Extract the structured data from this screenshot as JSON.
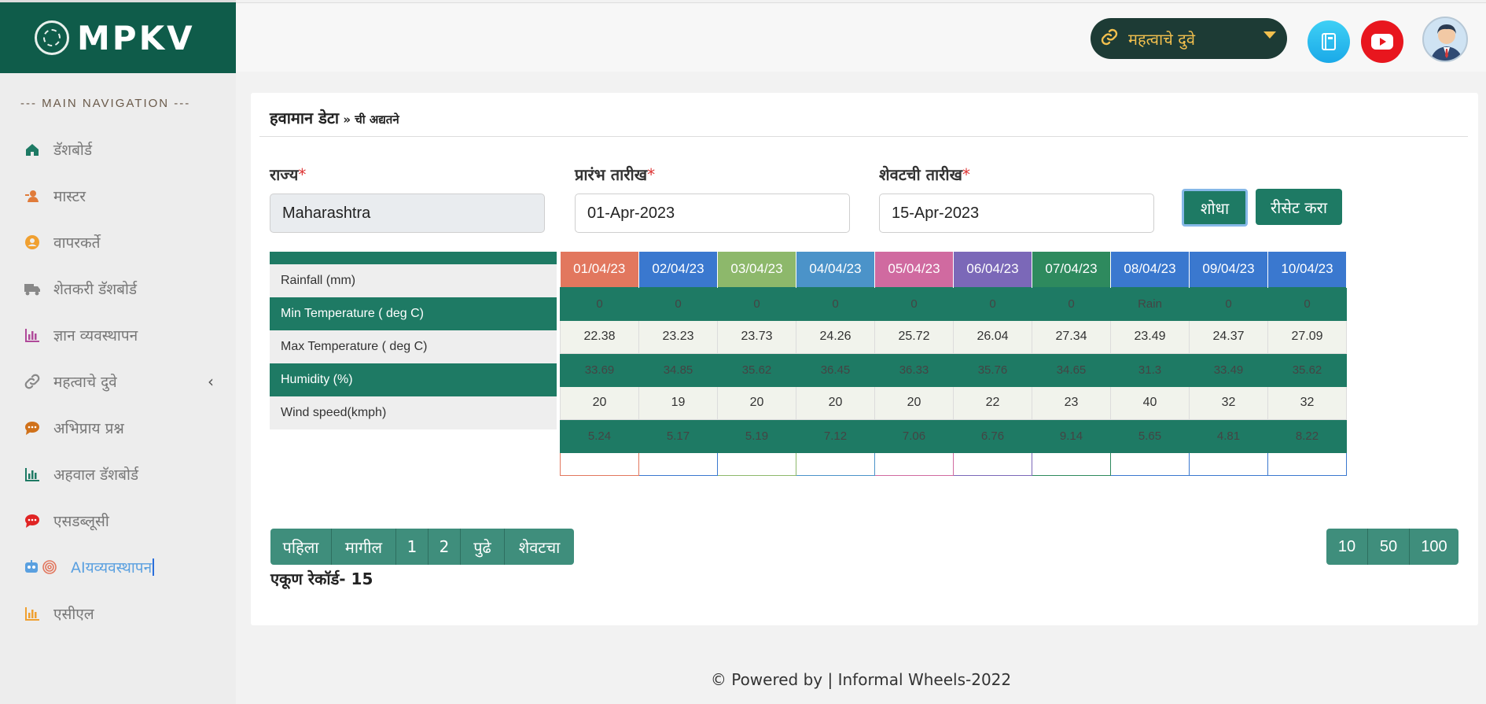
{
  "brand": {
    "name": "MPKV"
  },
  "sidebar": {
    "heading": "--- MAIN NAVIGATION ---",
    "items": [
      {
        "label": "डॅशबोर्ड",
        "icon": "home-icon",
        "color": "#1e7a64"
      },
      {
        "label": "मास्टर",
        "icon": "users-icon",
        "color": "#e07b3a"
      },
      {
        "label": "वापरकर्ते",
        "icon": "user-circle-icon",
        "color": "#f0a030"
      },
      {
        "label": "शेतकरी डॅशबोर्ड",
        "icon": "truck-icon",
        "color": "#888888"
      },
      {
        "label": "ज्ञान व्यवस्थापन",
        "icon": "bar-chart-icon",
        "color": "#b04a9a"
      },
      {
        "label": "महत्वाचे दुवे",
        "icon": "link-icon",
        "color": "#888888"
      },
      {
        "label": "अभिप्राय प्रश्न",
        "icon": "chat-icon",
        "color": "#d0711a"
      },
      {
        "label": "अहवाल डॅशबोर्ड",
        "icon": "bar-chart-icon",
        "color": "#1e7a64"
      },
      {
        "label": "एसडब्लूसी",
        "icon": "chat-icon",
        "color": "#e02424"
      },
      {
        "label": "AIयव्यवस्थापन",
        "icon": "robot-fingerprint-icon",
        "color": "#5aa0e0"
      },
      {
        "label": "एसीएल",
        "icon": "bar-chart-icon",
        "color": "#f0a030"
      }
    ]
  },
  "topbar": {
    "links_dropdown": "महत्वाचे दुवे"
  },
  "page": {
    "title": "हवामान डेटा",
    "title_suffix": " » ची अद्यतने"
  },
  "filters": {
    "state_label": "राज्य",
    "state_value": "Maharashtra",
    "start_label": "प्रारंभ तारीख",
    "start_value": "01-Apr-2023",
    "end_label": "शेवटची तारीख",
    "end_value": "15-Apr-2023",
    "required_mark": "*",
    "search_button": "शोधा",
    "reset_button": "रीसेट करा"
  },
  "weather_table": {
    "row_labels": [
      "Rainfall (mm)",
      "Min Temperature ( deg C)",
      "Max Temperature ( deg C)",
      "Humidity (%)",
      "Wind speed(kmph)"
    ],
    "columns": [
      {
        "date": "01/04/23",
        "color": "#e2775e",
        "values": [
          "0",
          "22.38",
          "33.69",
          "20",
          "5.24"
        ]
      },
      {
        "date": "02/04/23",
        "color": "#3a78cf",
        "values": [
          "0",
          "23.23",
          "34.85",
          "19",
          "5.17"
        ]
      },
      {
        "date": "03/04/23",
        "color": "#8db86b",
        "values": [
          "0",
          "23.73",
          "35.62",
          "20",
          "5.19"
        ]
      },
      {
        "date": "04/04/23",
        "color": "#4b93c9",
        "values": [
          "0",
          "24.26",
          "36.45",
          "20",
          "7.12"
        ]
      },
      {
        "date": "05/04/23",
        "color": "#d06aa0",
        "values": [
          "0",
          "25.72",
          "36.33",
          "20",
          "7.06"
        ]
      },
      {
        "date": "06/04/23",
        "color": "#7b68b8",
        "values": [
          "0",
          "26.04",
          "35.76",
          "22",
          "6.76"
        ]
      },
      {
        "date": "07/04/23",
        "color": "#2e8a5e",
        "values": [
          "0",
          "27.34",
          "34.65",
          "23",
          "9.14"
        ]
      },
      {
        "date": "08/04/23",
        "color": "#3a78cf",
        "values": [
          "Rain",
          "23.49",
          "31.3",
          "40",
          "5.65"
        ]
      },
      {
        "date": "09/04/23",
        "color": "#3a78cf",
        "values": [
          "0",
          "24.37",
          "33.49",
          "32",
          "4.81"
        ]
      },
      {
        "date": "10/04/23",
        "color": "#3a78cf",
        "values": [
          "0",
          "27.09",
          "35.62",
          "32",
          "8.22"
        ]
      }
    ]
  },
  "pagination": {
    "first": "पहिला",
    "prev": "मागील",
    "pages": [
      "1",
      "2"
    ],
    "next": "पुढे",
    "last": "शेवटचा",
    "page_sizes": [
      "10",
      "50",
      "100"
    ]
  },
  "records": {
    "label": "एकूण रेकॉर्ड",
    "count": "15"
  },
  "footer": {
    "text": "© Powered by | Informal Wheels-2022"
  }
}
